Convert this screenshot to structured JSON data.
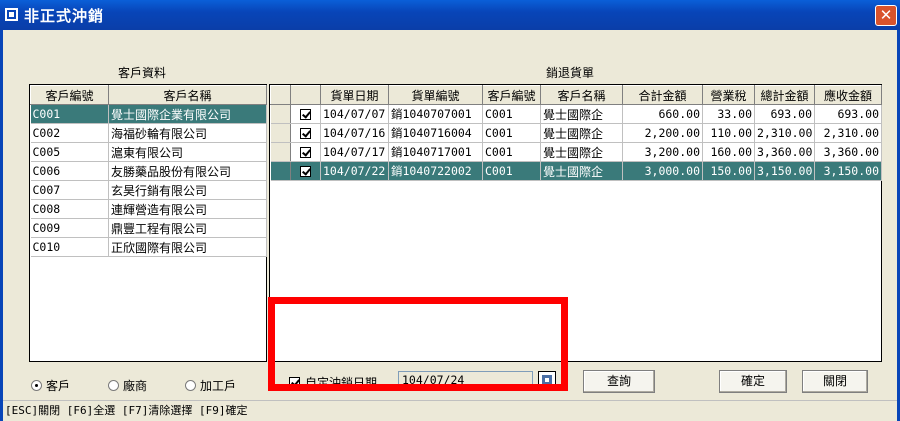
{
  "window": {
    "title": "非正式沖銷",
    "close": "✕"
  },
  "customers": {
    "section_label": "客戶資料",
    "headers": [
      "客戶編號",
      "客戶名稱"
    ],
    "rows": [
      [
        "C001",
        "覺士國際企業有限公司"
      ],
      [
        "C002",
        "海福砂輪有限公司"
      ],
      [
        "C005",
        "滬東有限公司"
      ],
      [
        "C006",
        "友勝藥品股份有限公司"
      ],
      [
        "C007",
        "玄昊行銷有限公司"
      ],
      [
        "C008",
        "連輝營造有限公司"
      ],
      [
        "C009",
        "鼎豐工程有限公司"
      ],
      [
        "C010",
        "正欣國際有限公司"
      ]
    ],
    "selected_index": 0
  },
  "returns": {
    "section_label": "銷退貨單",
    "headers": [
      "",
      "貨單日期",
      "貨單編號",
      "客戶編號",
      "客戶名稱",
      "合計金額",
      "營業稅",
      "總計金額",
      "應收金額"
    ],
    "rows": [
      [
        "104/07/07",
        "銷1040707001",
        "C001",
        "覺士國際企",
        "660.00",
        "33.00",
        "693.00",
        "693.00"
      ],
      [
        "104/07/16",
        "銷1040716004",
        "C001",
        "覺士國際企",
        "2,200.00",
        "110.00",
        "2,310.00",
        "2,310.00"
      ],
      [
        "104/07/17",
        "銷1040717001",
        "C001",
        "覺士國際企",
        "3,200.00",
        "160.00",
        "3,360.00",
        "3,360.00"
      ],
      [
        "104/07/22",
        "銷1040722002",
        "C001",
        "覺士國際企",
        "3,000.00",
        "150.00",
        "3,150.00",
        "3,150.00"
      ]
    ],
    "checked": [
      true,
      true,
      true,
      true
    ],
    "selected_index": 3
  },
  "radios": [
    {
      "label": "客戶",
      "checked": true
    },
    {
      "label": "廠商",
      "checked": false
    },
    {
      "label": "加工戶",
      "checked": false
    }
  ],
  "custom_date": {
    "label": "自定沖銷日期",
    "checked": true,
    "value": "104/07/24"
  },
  "buttons": {
    "query": "查詢",
    "confirm": "確定",
    "close": "關閉"
  },
  "status": "[ESC]關閉 [F6]全選 [F7]清除選擇 [F9]確定"
}
